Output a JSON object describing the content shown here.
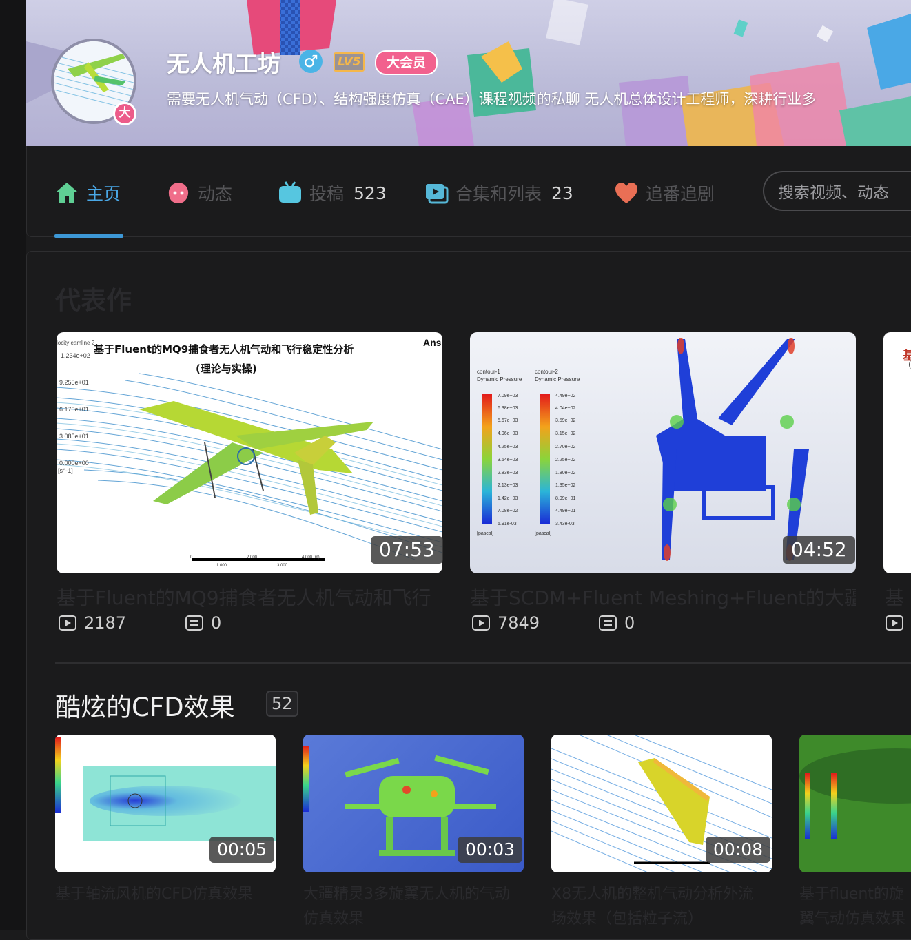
{
  "profile": {
    "name": "无人机工坊",
    "gender_icon": "male-icon",
    "level": "LV5",
    "vip_label": "大会员",
    "avatar_badge": "大",
    "signature": "需要无人机气动（CFD）、结构强度仿真（CAE）课程视频的私聊 无人机总体设计工程师，深耕行业多"
  },
  "nav": {
    "tabs": [
      {
        "label": "主页",
        "count": "",
        "icon": "home-icon"
      },
      {
        "label": "动态",
        "count": "",
        "icon": "dynamic-icon"
      },
      {
        "label": "投稿",
        "count": "523",
        "icon": "tv-icon"
      },
      {
        "label": "合集和列表",
        "count": "23",
        "icon": "playlist-icon"
      },
      {
        "label": "追番追剧",
        "count": "",
        "icon": "heart-icon"
      }
    ],
    "search_placeholder": "搜索视频、动态"
  },
  "masterpiece": {
    "title": "代表作",
    "videos": [
      {
        "title": "基于Fluent的MQ9捕食者无人机气动和飞行",
        "duration": "07:53",
        "views": "2187",
        "comments": "0",
        "thumb_text": {
          "headline": "基于Fluent的MQ9捕食者无人机气动和飞行稳定性分析",
          "sub": "(理论与实操)",
          "legend_vals": [
            "1.234e+02",
            "9.255e+01",
            "6.170e+01",
            "3.085e+01",
            "0.000e+00"
          ],
          "legend_header": "locity eamline 2",
          "unit": "[s^-1]",
          "brand": "Ans",
          "scale": [
            "0",
            "2.000",
            "4.000 (m)",
            "1.000",
            "3.000"
          ]
        }
      },
      {
        "title": "基于SCDM+Fluent Meshing+Fluent的大疆",
        "duration": "04:52",
        "views": "7849",
        "comments": "0",
        "thumb_text": {
          "c1_head": [
            "contour-1",
            "Dynamic Pressure"
          ],
          "c1_vals": [
            "7.09e+03",
            "6.38e+03",
            "5.67e+03",
            "4.96e+03",
            "4.25e+03",
            "3.54e+03",
            "2.83e+03",
            "2.13e+03",
            "1.42e+03",
            "7.08e+02",
            "5.91e-03"
          ],
          "c2_head": [
            "contour-2",
            "Dynamic Pressure"
          ],
          "c2_vals": [
            "4.49e+02",
            "4.04e+02",
            "3.59e+02",
            "3.15e+02",
            "2.70e+02",
            "2.25e+02",
            "1.80e+02",
            "1.35e+02",
            "8.99e+01",
            "4.49e+01",
            "3.43e-03"
          ],
          "unit": "[pascal]"
        }
      },
      {
        "title": "基",
        "thumb_text": {
          "headline": "基",
          "sub": "("
        }
      }
    ]
  },
  "cfd_section": {
    "title": "酷炫的CFD效果",
    "count": "52",
    "videos": [
      {
        "title": "基于轴流风机的CFD仿真效果",
        "duration": "00:05"
      },
      {
        "title": "大疆精灵3多旋翼无人机的气动仿真效果",
        "duration": "00:03"
      },
      {
        "title": "X8无人机的整机气动分析外流场效果（包括粒子流）",
        "duration": "00:08"
      },
      {
        "title": "基于fluent的旋翼气动仿真效果展示",
        "duration": ""
      }
    ]
  },
  "colors": {
    "accent": "#4aa8e6",
    "underline": "#3d98d6",
    "vip": "#f2618e",
    "level": "#f5b74a"
  }
}
